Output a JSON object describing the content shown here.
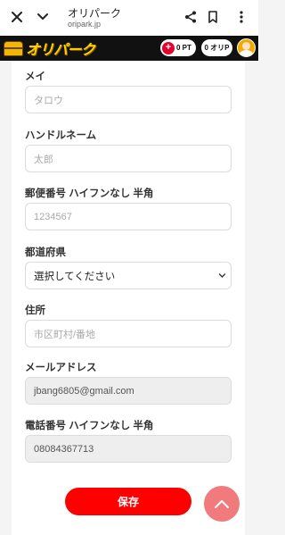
{
  "browser": {
    "site_title": "オリパーク",
    "url": "oripark.jp"
  },
  "header": {
    "logo_text": "オリパーク",
    "points_label": "0 PT",
    "orip_label": "0 オリP"
  },
  "form": {
    "fields": [
      {
        "label": "メイ",
        "value": "タロウ",
        "kind": "placeholder"
      },
      {
        "label": "ハンドルネーム",
        "value": "太郎",
        "kind": "placeholder"
      },
      {
        "label": "郵便番号 ハイフンなし 半角",
        "value": "1234567",
        "kind": "placeholder"
      },
      {
        "label": "都道府県",
        "value": "選択してください",
        "kind": "select"
      },
      {
        "label": "住所",
        "value": "市区町村/番地",
        "kind": "placeholder"
      },
      {
        "label": "メールアドレス",
        "value": "jbang6805@gmail.com",
        "kind": "readonly"
      },
      {
        "label": "電話番号 ハイフンなし 半角",
        "value": "08084367713",
        "kind": "readonly"
      }
    ],
    "save_label": "保存"
  },
  "colors": {
    "accent": "#ff0000",
    "header_bg": "#111111",
    "logo": "#ffd200",
    "scroll_top": "#f07a7c"
  },
  "icons": [
    "close-icon",
    "chevron-down-icon",
    "share-icon",
    "bookmark-icon",
    "more-vert-icon",
    "treasure-chest-icon",
    "plus-icon",
    "avatar",
    "chevron-up-icon"
  ]
}
